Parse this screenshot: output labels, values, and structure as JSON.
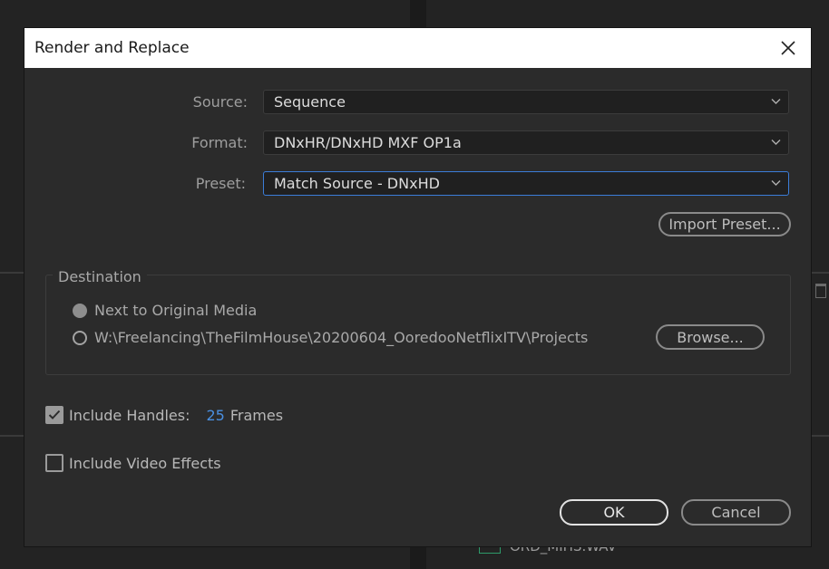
{
  "background": {
    "file_name": "ORD_MIHS.WAV"
  },
  "dialog": {
    "title": "Render and Replace",
    "source": {
      "label": "Source:",
      "value": "Sequence"
    },
    "format": {
      "label": "Format:",
      "value": "DNxHR/DNxHD MXF OP1a"
    },
    "preset": {
      "label": "Preset:",
      "value": "Match Source - DNxHD"
    },
    "import_preset_label": "Import Preset...",
    "destination": {
      "legend": "Destination",
      "option_next_to_original": "Next to Original Media",
      "option_path": "W:\\Freelancing\\TheFilmHouse\\20200604_OoredooNetflixITV\\Projects",
      "browse_label": "Browse..."
    },
    "include_handles": {
      "label": "Include Handles:",
      "value": "25",
      "unit": "Frames",
      "checked": true
    },
    "include_video_effects": {
      "label": "Include Video Effects",
      "checked": false
    },
    "ok_label": "OK",
    "cancel_label": "Cancel"
  },
  "colors": {
    "accent": "#3b7dd8",
    "handles_value": "#4a90e2",
    "dialog_bg": "#2b2b2b"
  }
}
